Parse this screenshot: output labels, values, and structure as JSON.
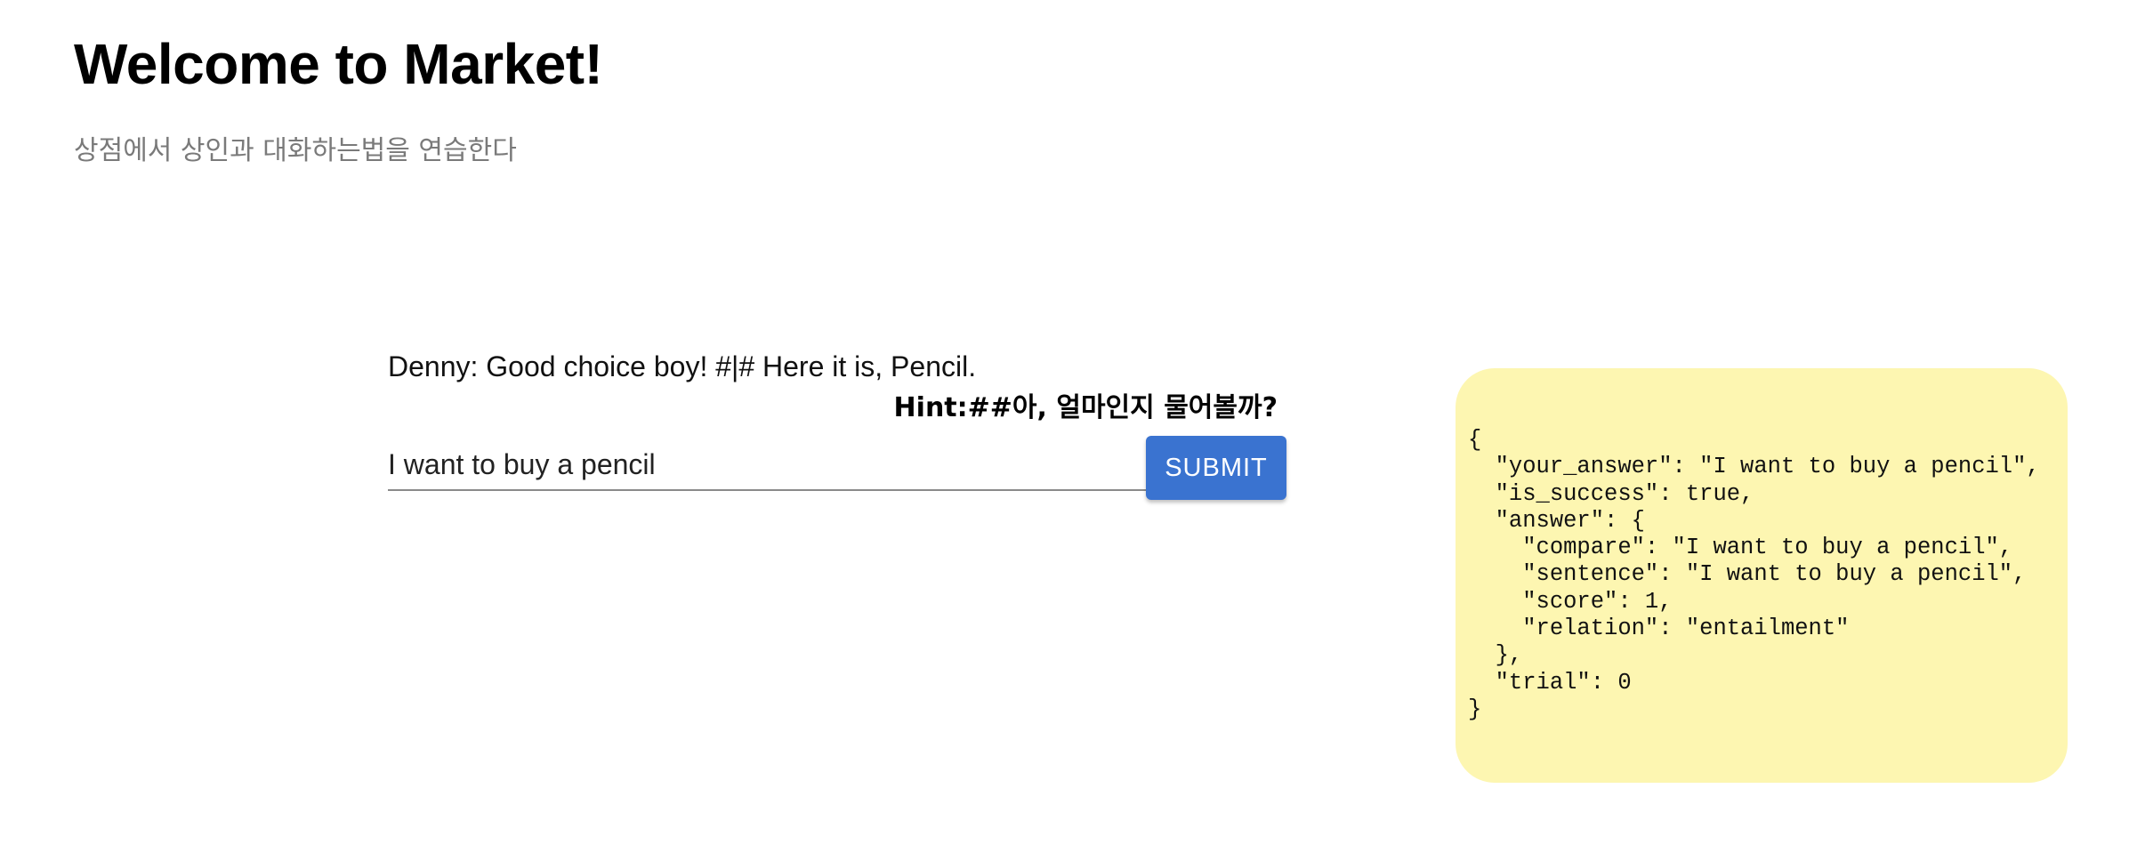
{
  "header": {
    "title": "Welcome to Market!",
    "subtitle": "상점에서 상인과 대화하는법을 연습한다"
  },
  "chat": {
    "dialog": "Denny: Good choice boy! #|# Here it is, Pencil.",
    "hint": "Hint:##아, 얼마인지 물어볼까?",
    "input_value": "I want to buy a pencil",
    "submit_label": "SUBMIT"
  },
  "result": {
    "json_text": "{\n  \"your_answer\": \"I want to buy a pencil\",\n  \"is_success\": true,\n  \"answer\": {\n    \"compare\": \"I want to buy a pencil\",\n    \"sentence\": \"I want to buy a pencil\",\n    \"score\": 1,\n    \"relation\": \"entailment\"\n  },\n  \"trial\": 0\n}"
  },
  "colors": {
    "accent": "#3a73d0",
    "result_background": "#fdf6b1",
    "subtitle": "#7a7a7a"
  }
}
